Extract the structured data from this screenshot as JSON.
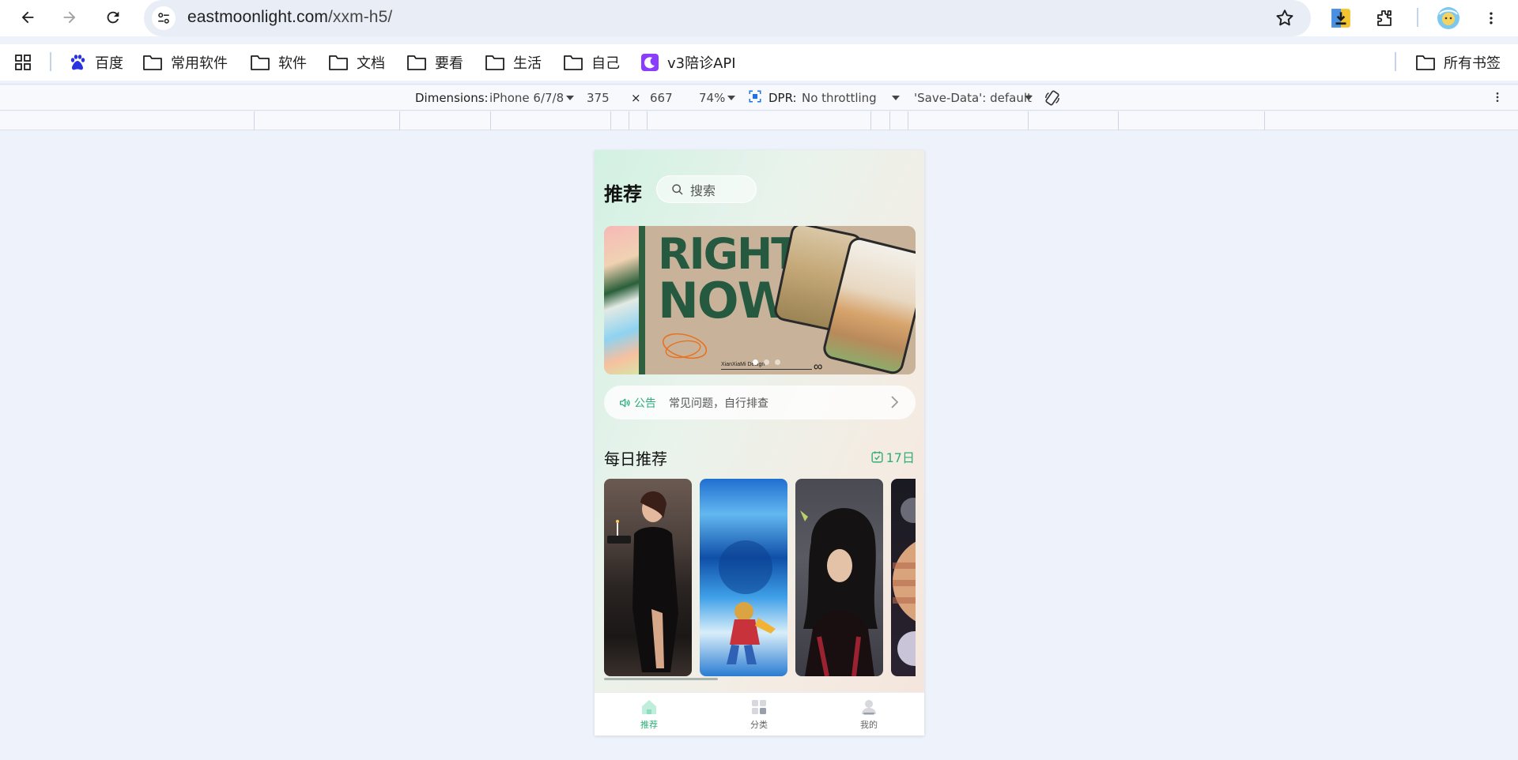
{
  "browser": {
    "url_host": "eastmoonlight.com",
    "url_path": "/xxm-h5/",
    "bookmarks": [
      {
        "label": "百度",
        "icon": "baidu-paw-icon"
      },
      {
        "label": "常用软件",
        "icon": "folder-icon"
      },
      {
        "label": "软件",
        "icon": "folder-icon"
      },
      {
        "label": "文档",
        "icon": "folder-icon"
      },
      {
        "label": "要看",
        "icon": "folder-icon"
      },
      {
        "label": "生活",
        "icon": "folder-icon"
      },
      {
        "label": "自己",
        "icon": "folder-icon"
      },
      {
        "label": "v3陪诊API",
        "icon": "moon-app-icon"
      }
    ],
    "all_bookmarks": "所有书签"
  },
  "devtools": {
    "dimensions_label": "Dimensions:",
    "device": "iPhone 6/7/8",
    "width": "375",
    "times": "×",
    "height": "667",
    "zoom": "74%",
    "dpr_label": "DPR:",
    "throttling": "No throttling",
    "save_data": "'Save-Data': default"
  },
  "app": {
    "title": "推荐",
    "search_placeholder": "搜索",
    "banner": {
      "line1": "RIGHT",
      "line2": "NOW",
      "credit": "XianXiaMi Design",
      "slide_count": 3,
      "active_slide": 1
    },
    "notice": {
      "tag": "公告",
      "text": "常见问题，自行排查"
    },
    "daily": {
      "title": "每日推荐",
      "date": "17日"
    },
    "tabs": [
      {
        "label": "推荐",
        "active": true,
        "icon": "home-icon"
      },
      {
        "label": "分类",
        "active": false,
        "icon": "category-grid-icon"
      },
      {
        "label": "我的",
        "active": false,
        "icon": "user-icon"
      }
    ],
    "colors": {
      "accent": "#2fae7a",
      "inactive_tab": "#666666"
    }
  }
}
